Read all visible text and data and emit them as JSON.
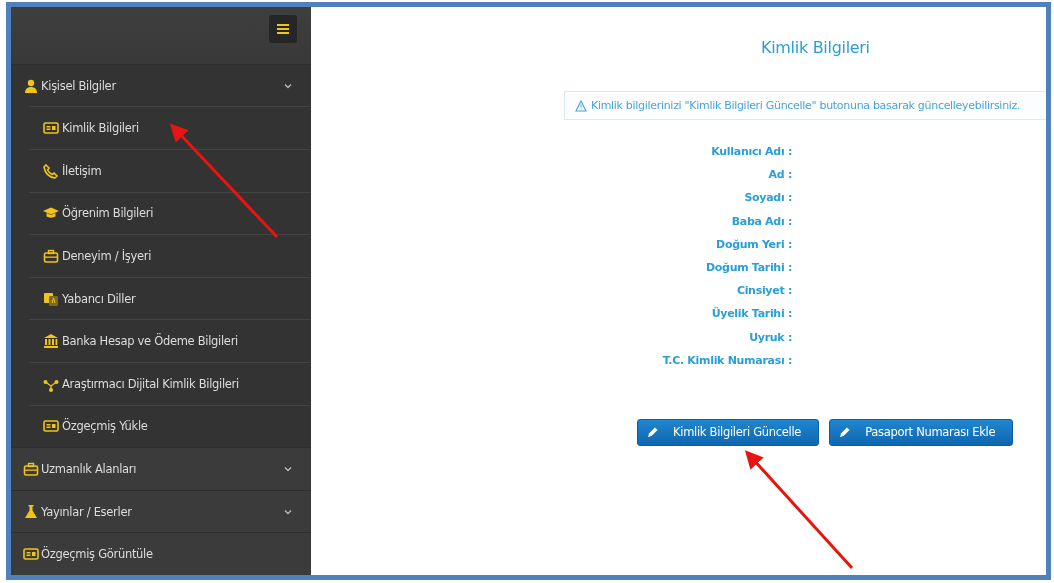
{
  "sidebar": {
    "menu": [
      {
        "kind": "group",
        "label": "Kişisel Bilgiler",
        "expanded": true,
        "children": [
          {
            "label": "Kimlik Bilgileri"
          },
          {
            "label": "İletişim"
          },
          {
            "label": "Öğrenim Bilgileri"
          },
          {
            "label": "Deneyim / İşyeri"
          },
          {
            "label": "Yabancı Diller"
          },
          {
            "label": "Banka Hesap ve Ödeme Bilgileri"
          },
          {
            "label": "Araştırmacı Dijital Kimlik Bilgileri"
          },
          {
            "label": "Özgeçmiş Yükle"
          }
        ]
      },
      {
        "kind": "group",
        "label": "Uzmanlık Alanları",
        "expanded": false
      },
      {
        "kind": "group",
        "label": "Yayınlar / Eserler",
        "expanded": false
      },
      {
        "kind": "link",
        "label": "Özgeçmiş Görüntüle"
      }
    ]
  },
  "main": {
    "title": "Kimlik Bilgileri",
    "alert": "Kimlik bilgilerinizi \"Kimlik Bilgileri Güncelle\" butonuna basarak güncelleyebilirsiniz.",
    "fields": [
      "Kullanıcı Adı :",
      "Ad :",
      "Soyadı :",
      "Baba Adı :",
      "Doğum Yeri :",
      "Doğum Tarihi :",
      "Cinsiyet :",
      "Üyelik Tarihi :",
      "Uyruk :",
      "T.C. Kimlik Numarası :"
    ],
    "buttons": [
      {
        "label": "Kimlik Bilgileri Güncelle"
      },
      {
        "label": "Pasaport Numarası Ekle"
      }
    ]
  }
}
